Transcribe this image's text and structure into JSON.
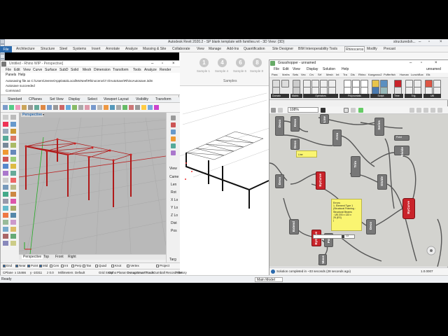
{
  "revit": {
    "title": "Autodesk Revit 2020.2 - SP blank template with families.rvt - 3D View: {3D}",
    "user": "structuredsh...",
    "tabs": [
      "File",
      "Architecture",
      "Structure",
      "Steel",
      "Systems",
      "Insert",
      "Annotate",
      "Analyze",
      "Massing & Site",
      "Collaborate",
      "View",
      "Manage",
      "Add-Ins",
      "Quantification",
      "Site Designer",
      "BIM Interoperability Tools",
      "Rhinoceros",
      "Modify",
      "Precast"
    ],
    "active_tab": "Rhinoceros",
    "samples": [
      {
        "num": "1",
        "label": "Sample 1"
      },
      {
        "num": "4",
        "label": "Sample 4"
      },
      {
        "num": "6",
        "label": "Sample 6"
      },
      {
        "num": "8",
        "label": "Sample 8"
      }
    ],
    "samples_panel": "Samples",
    "status_left": "Ready",
    "status_model": "Main Model"
  },
  "rhino": {
    "title": "Untitled - Rhino WIP - Perspective]",
    "menu": [
      "File",
      "Edit",
      "View",
      "Curve",
      "Surface",
      "SubD",
      "Solid",
      "Mesh",
      "Dimension",
      "Transform",
      "Tools",
      "Analyze",
      "Render"
    ],
    "menu2": [
      "Panels",
      "Help"
    ],
    "cmd_lines": [
      "Autosaving file as C:\\Users\\Jeeree\\AppData\\Local\\McNeel\\Rhinoceros\\7.0\\AutoSave\\RhinoAutosave.3dm",
      "Autosave succeeded",
      "Command:"
    ],
    "tabs": [
      "Standard",
      "CPlanes",
      "Set View",
      "Display",
      "Select",
      "Viewport Layout",
      "Visibility",
      "Transform"
    ],
    "viewport_label": "Perspective",
    "bottom_tabs": [
      "Perspective",
      "Top",
      "Front",
      "Right"
    ],
    "osnap": [
      "End",
      "Near",
      "Point",
      "Mid",
      "Cen",
      "Int",
      "Perp",
      "Tan",
      "Quad",
      "Knot",
      "Vertex",
      "Project"
    ],
    "osnap_checked": [
      true,
      true,
      true,
      true,
      false,
      false,
      false,
      false,
      false,
      false,
      false,
      false
    ],
    "status": [
      "CPlane",
      "x 15466",
      "y -10311",
      "z 0.0",
      "Millimeters",
      "Default",
      "Grid Snap",
      "Ortho",
      "Planar",
      "Osnap",
      "SmartTrack",
      "Gumball",
      "Record History",
      "Filter"
    ],
    "right_labels": [
      "View",
      "Came",
      "Len",
      "Rot",
      "X Lo",
      "Y Lo",
      "Z Lo",
      "Dist",
      "Pos",
      "Targ"
    ]
  },
  "grasshopper": {
    "title": "Grasshopper - unnamed",
    "menu": [
      "File",
      "Edit",
      "View",
      "Display",
      "Solution",
      "Help"
    ],
    "doc_name": "unnamed",
    "tabs": [
      "Para",
      "Maths",
      "Sets",
      "Vec",
      "Crv",
      "Srf",
      "Mesh",
      "Int",
      "Tra",
      "Dis",
      "Rhino",
      "Kangaroo2",
      "Pufferfish",
      "Human",
      "LunchBox",
      "Elk"
    ],
    "categories": [
      "Domain",
      "Matrix",
      "Operators",
      "Polynomials",
      "Script",
      "Time",
      "Trig",
      "Util"
    ],
    "zoom": "108%",
    "panel_small": "Line",
    "panel_text": "Errors:\n1. Element Type 1\n(Structural Framing :\nStructural Beams\n: UB 203 x 133 x\n25 (ES)\n)",
    "slider_val": "13",
    "nodes": [
      "Deco",
      "Deco",
      "Line",
      "Area",
      "Series",
      "Divide",
      "Deco",
      "Trim",
      "Deco",
      "Divide",
      "Deco",
      "ByCurve",
      "ByCurve",
      "Point",
      "Point",
      "Ln",
      "Move",
      "ByCurve",
      "Extend"
    ],
    "status": "Solution completed in ~33 seconds (28 seconds ago)",
    "version": "1.0.0007"
  },
  "colors": {
    "revit_blue": "#2b6aad",
    "gh_red": "#c9232a",
    "gh_canvas": "#d3d3cf",
    "rhino_vp": "#b8b8b8"
  }
}
